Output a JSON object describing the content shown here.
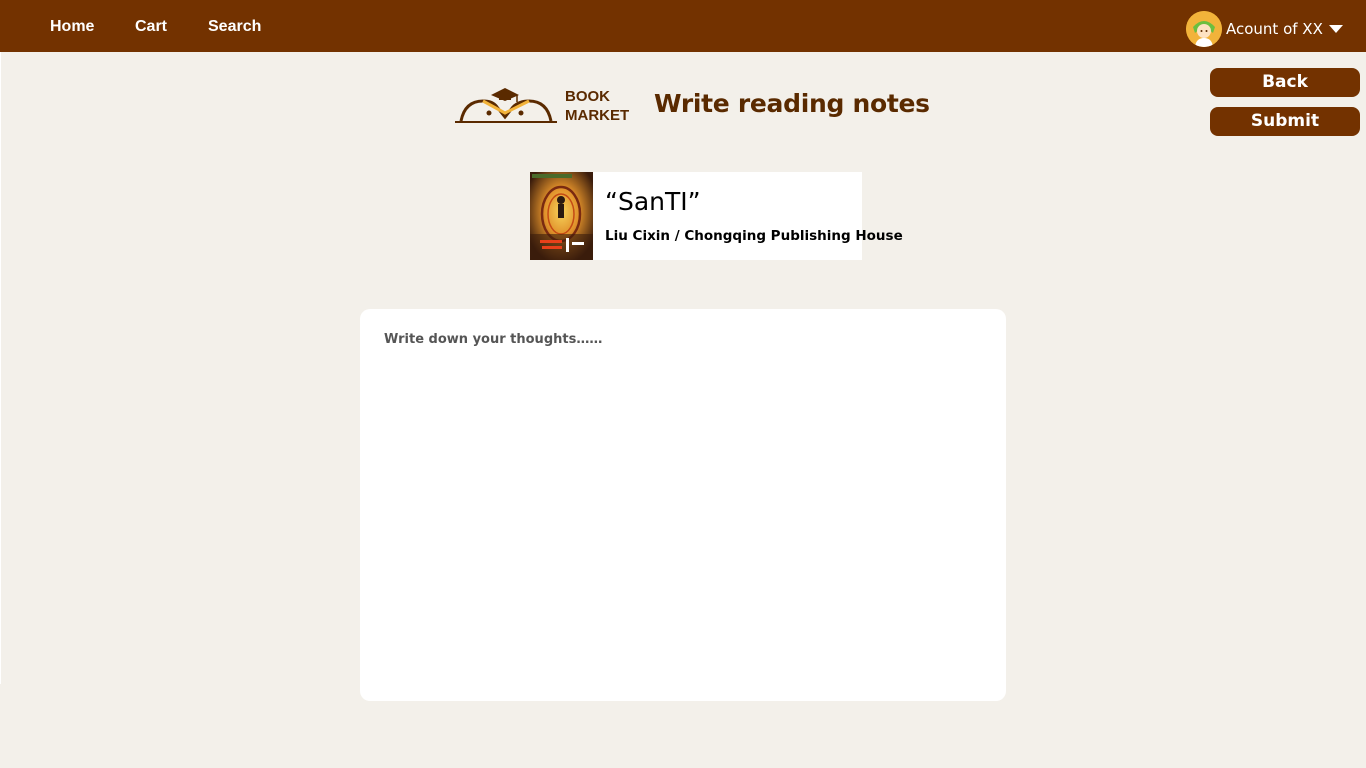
{
  "nav": {
    "home": "Home",
    "cart": "Cart",
    "search": "Search"
  },
  "account": {
    "name": "Acount of XX",
    "avatar_icon": "user-avatar-icon",
    "dropdown_icon": "caret-down-icon"
  },
  "brand": {
    "line1": "BOOK",
    "line2": "MARKET",
    "logo_icon": "graduation-cap-book-logo"
  },
  "page": {
    "title": "Write reading notes"
  },
  "actions": {
    "back": "Back",
    "submit": "Submit"
  },
  "book": {
    "title": "“SanTI”",
    "author_publisher": "Liu Cixin / Chongqing Publishing House"
  },
  "notes": {
    "value": "",
    "placeholder": "Write down your thoughts……"
  },
  "colors": {
    "primary": "#733200",
    "heading": "#5a2a00",
    "background": "#f3f0ea",
    "card": "#ffffff"
  }
}
